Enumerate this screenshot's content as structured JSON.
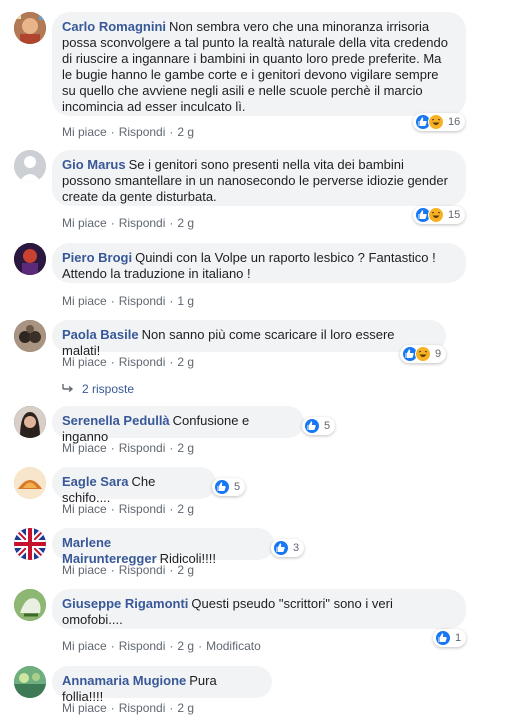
{
  "comments": [
    {
      "author": "Carlo Romagnini",
      "text": "Non sembra vero che una minoranza irrisoria possa sconvolgere a tal punto la realtà naturale della vita credendo di riuscire a ingannare i bambini in quanto loro prede preferite. Ma le bugie hanno le gambe corte e i genitori devono vigilare sempre su quello che avviene negli asili e nelle scuole perchè il marcio incomincia ad esser inculcato lì.",
      "like": "Mi piace",
      "reply": "Rispondi",
      "time": "2 g",
      "reactions": [
        "like",
        "haha"
      ],
      "count": "16"
    },
    {
      "author": "Gio Marus",
      "text": "Se i genitori sono presenti nella vita dei bambini possono smantellare in un nanosecondo le perverse idiozie gender create da gente disturbata.",
      "like": "Mi piace",
      "reply": "Rispondi",
      "time": "2 g",
      "reactions": [
        "like",
        "haha"
      ],
      "count": "15"
    },
    {
      "author": "Piero Brogi",
      "text": "Quindi con la Volpe un raporto lesbico ? Fantastico ! Attendo la traduzione in italiano !",
      "like": "Mi piace",
      "reply": "Rispondi",
      "time": "1 g"
    },
    {
      "author": "Paola Basile",
      "text": "Non sanno più come scaricare il loro essere malati!",
      "like": "Mi piace",
      "reply": "Rispondi",
      "time": "2 g",
      "reactions": [
        "like",
        "haha"
      ],
      "count": "9",
      "replies": "2 risposte"
    },
    {
      "author": "Serenella Pedullà",
      "text": "Confusione e inganno",
      "like": "Mi piace",
      "reply": "Rispondi",
      "time": "2 g",
      "reactions": [
        "like"
      ],
      "count": "5"
    },
    {
      "author": "Eagle Sara",
      "text": "Che schifo....",
      "like": "Mi piace",
      "reply": "Rispondi",
      "time": "2 g",
      "reactions": [
        "like"
      ],
      "count": "5"
    },
    {
      "author": "Marlene Mairunteregger",
      "text": "Ridicoli!!!!",
      "like": "Mi piace",
      "reply": "Rispondi",
      "time": "2 g",
      "reactions": [
        "like"
      ],
      "count": "3"
    },
    {
      "author": "Giuseppe Rigamonti",
      "text": "Questi pseudo \"scrittori\" sono i veri omofobi....",
      "like": "Mi piace",
      "reply": "Rispondi",
      "time": "2 g",
      "edited": "Modificato",
      "reactions": [
        "like"
      ],
      "count": "1"
    },
    {
      "author": "Annamaria Mugione",
      "text": "Pura follia!!!!",
      "like": "Mi piace",
      "reply": "Rispondi",
      "time": "2 g"
    }
  ],
  "colors": {
    "bubble": "#f2f3f5",
    "author": "#385898",
    "meta": "#606770",
    "like": "#1877f2",
    "haha": "#f7b125"
  },
  "icons": {
    "like": "thumbs-up-icon",
    "haha": "laughing-face-icon",
    "replies": "reply-arrow-icon"
  }
}
